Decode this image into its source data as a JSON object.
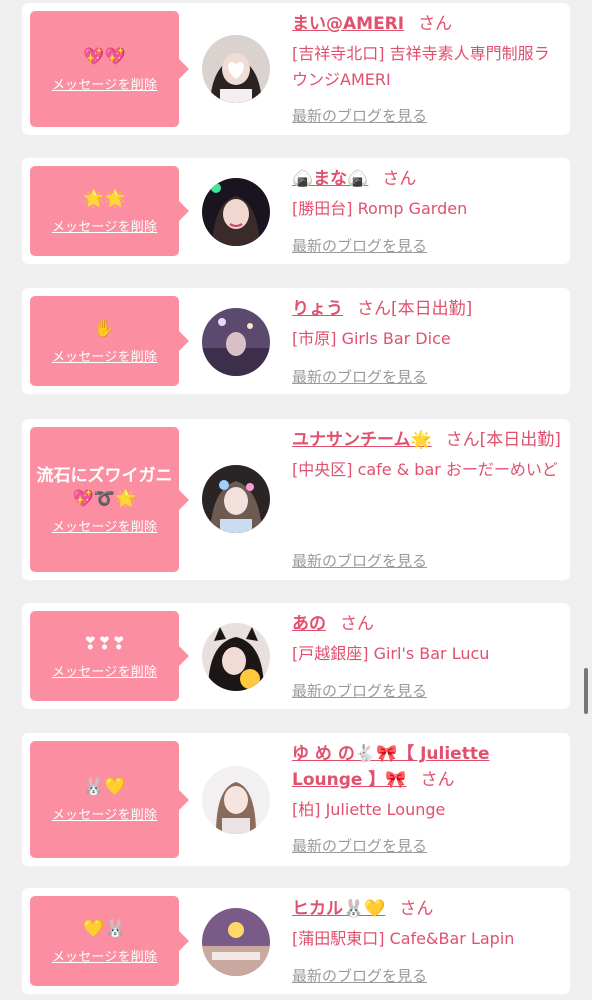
{
  "delete_label": "メッセージを削除",
  "blog_label": "最新のブログを見る",
  "san_label": "さん",
  "colors": {
    "bubble": "#fb8fa1",
    "name": "#e1506d",
    "link_gray": "#9a9a9a"
  },
  "items": [
    {
      "message": "",
      "emojis": "💖💖",
      "name": "まい@AMERI",
      "status": "",
      "shop": "[吉祥寺北口] 吉祥寺素人専門制服ラウンジAMERI",
      "avatar": "girl-with-heart-face-avatar"
    },
    {
      "message": "",
      "emojis": "🌟🌟",
      "name": "🍙まな🍙",
      "status": "",
      "shop": "[勝田台] Romp Garden",
      "avatar": "girl-selfie-avatar"
    },
    {
      "message": "",
      "emojis": "✋",
      "name": "りょう",
      "status": "[本日出勤]",
      "shop": "[市原] Girls Bar Dice",
      "avatar": "bar-interior-avatar"
    },
    {
      "message": "流石にズワイガニ",
      "emojis": "💖➰🌟",
      "name": "ユナサンチーム🌟",
      "status": "[本日出勤]",
      "shop": "[中央区] cafe & bar おーだーめいど",
      "avatar": "girl-with-stickers-avatar"
    },
    {
      "message": "",
      "emojis": "❣❣❣",
      "name": "あの",
      "status": "",
      "shop": "[戸越銀座] Girl's Bar Lucu",
      "avatar": "girl-cat-ears-avatar"
    },
    {
      "message": "",
      "emojis": "🐰💛",
      "name": "ゆ め の🐇🎀【 Juliette Lounge 】🎀",
      "status": "",
      "shop": "[柏] Juliette Lounge",
      "avatar": "girl-portrait-avatar"
    },
    {
      "message": "",
      "emojis": "💛🐰",
      "name": "ヒカル🐰💛",
      "status": "",
      "shop": "[蒲田駅東口] Cafe&Bar Lapin",
      "avatar": "cafe-interior-avatar"
    }
  ]
}
